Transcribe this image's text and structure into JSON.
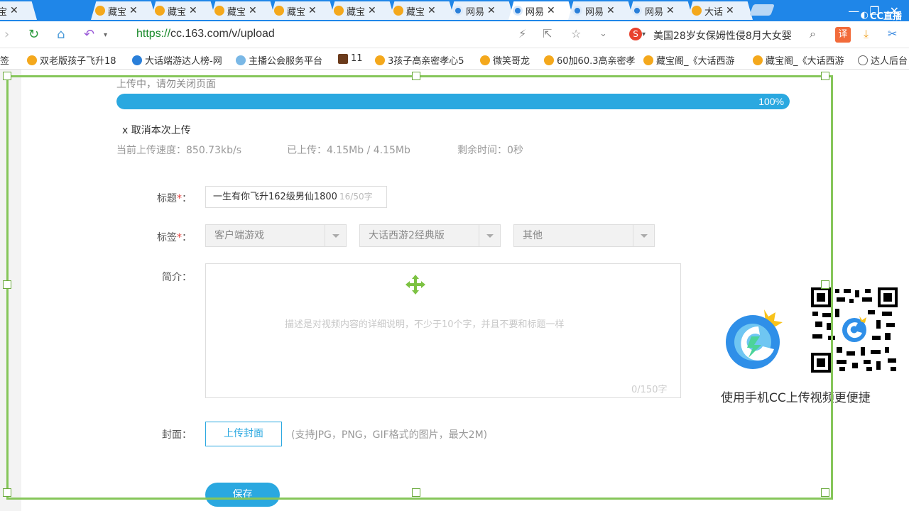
{
  "tabs": [
    {
      "title": "藏宝",
      "icon": "treasure-icon",
      "active": false
    },
    {
      "title": "藏宝",
      "icon": "treasure-icon",
      "active": false
    },
    {
      "title": "藏宝",
      "icon": "treasure-icon",
      "active": false
    },
    {
      "title": "藏宝",
      "icon": "treasure-icon",
      "active": false
    },
    {
      "title": "藏宝",
      "icon": "treasure-icon",
      "active": false
    },
    {
      "title": "藏宝",
      "icon": "treasure-icon",
      "active": false
    },
    {
      "title": "藏宝",
      "icon": "treasure-icon",
      "active": false
    },
    {
      "title": "网易",
      "icon": "cc-icon",
      "active": false
    },
    {
      "title": "网易",
      "icon": "cc-icon",
      "active": true
    },
    {
      "title": "网易",
      "icon": "cc-icon",
      "active": false
    },
    {
      "title": "网易",
      "icon": "cc-icon",
      "active": false
    },
    {
      "title": "大话",
      "icon": "treasure-icon",
      "active": false
    }
  ],
  "brand": "CC直播",
  "address": {
    "url_prefix": "https://",
    "url_rest": "cc.163.com/v/upload"
  },
  "search": {
    "text": "美国28岁女保姆性侵8月大女婴"
  },
  "translate_label": "译",
  "bookmarks": [
    {
      "label": "签",
      "icon": "none"
    },
    {
      "label": "双老版孩子飞升18",
      "icon": "bao"
    },
    {
      "label": "大话端游达人榜-网",
      "icon": "cc"
    },
    {
      "label": "主播公会服务平台",
      "icon": "face"
    },
    {
      "label": "11",
      "icon": "sq"
    },
    {
      "label": "3孩子高亲密孝心5",
      "icon": "bao"
    },
    {
      "label": "微笑哥龙",
      "icon": "bao"
    },
    {
      "label": "60加60.3高亲密孝",
      "icon": "bao"
    },
    {
      "label": "藏宝阁_《大话西游",
      "icon": "bao"
    },
    {
      "label": "藏宝阁_《大话西游",
      "icon": "bao"
    },
    {
      "label": "达人后台",
      "icon": "globe"
    }
  ],
  "upload": {
    "status": "上传中，请勿关闭页面",
    "progress": 100,
    "progress_text": "100%",
    "cancel": "x 取消本次上传",
    "speed": "当前上传速度：850.73kb/s",
    "uploaded": "已上传：4.15Mb / 4.15Mb",
    "remaining": "剩余时间：0秒"
  },
  "form": {
    "title_label": "标题",
    "title_required": "*",
    "title_colon": "：",
    "title_value": "一生有你飞升162级男仙1800",
    "title_count": "16/50字",
    "tags_label": "标签",
    "tags_required": "*",
    "tags_colon": "：",
    "tags": [
      "客户端游戏",
      "大话西游2经典版",
      "其他"
    ],
    "desc_label": "简介：",
    "desc_placeholder": "描述是对视频内容的详细说明，不少于10个字，并且不要和标题一样",
    "desc_count": "0/150字",
    "cover_label": "封面：",
    "cover_button": "上传封面",
    "cover_hint": "(支持JPG，PNG，GIF格式的图片，最大2M)",
    "save_button": "保存"
  },
  "promo": {
    "caption": "使用手机CC上传视频更便捷"
  },
  "colors": {
    "accent": "#2aa8e0",
    "capture_frame": "#86c65a",
    "tabbar": "#1f86e8",
    "url_green": "#1a8a2b"
  }
}
